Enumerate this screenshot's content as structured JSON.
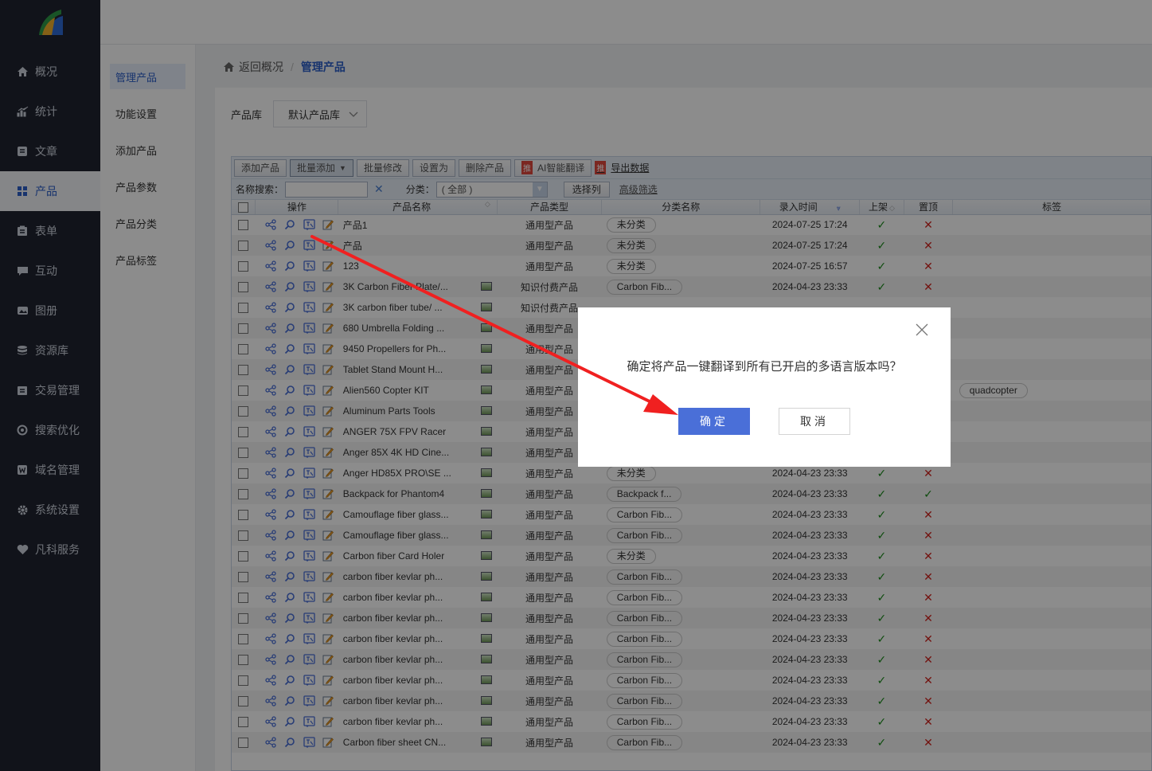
{
  "sidebar": {
    "items": [
      {
        "label": "概况",
        "icon": "home-icon"
      },
      {
        "label": "统计",
        "icon": "stats-icon"
      },
      {
        "label": "文章",
        "icon": "article-icon"
      },
      {
        "label": "产品",
        "icon": "product-icon",
        "active": true
      },
      {
        "label": "表单",
        "icon": "form-icon"
      },
      {
        "label": "互动",
        "icon": "chat-icon"
      },
      {
        "label": "图册",
        "icon": "gallery-icon"
      },
      {
        "label": "资源库",
        "icon": "database-icon"
      },
      {
        "label": "交易管理",
        "icon": "trade-icon"
      },
      {
        "label": "搜索优化",
        "icon": "seo-icon"
      },
      {
        "label": "域名管理",
        "icon": "domain-icon"
      },
      {
        "label": "系统设置",
        "icon": "gear-icon"
      },
      {
        "label": "凡科服务",
        "icon": "heart-icon"
      }
    ]
  },
  "submenu": {
    "items": [
      {
        "label": "管理产品",
        "active": true
      },
      {
        "label": "功能设置"
      },
      {
        "label": "添加产品"
      },
      {
        "label": "产品参数"
      },
      {
        "label": "产品分类"
      },
      {
        "label": "产品标签"
      }
    ]
  },
  "breadcrumb": {
    "back": "返回概况",
    "current": "管理产品"
  },
  "library": {
    "label": "产品库",
    "value": "默认产品库"
  },
  "toolbar": {
    "add": "添加产品",
    "batch_add": "批量添加",
    "batch_edit": "批量修改",
    "set_as": "设置为",
    "delete": "删除产品",
    "ai_badge": "推",
    "ai_translate": "AI智能翻译",
    "export_badge": "推",
    "export": "导出数据"
  },
  "search": {
    "name_label": "名称搜索：",
    "clear": "✕",
    "category_label": "分类：",
    "category_value": "( 全部 )",
    "select_columns": "选择列",
    "advanced": "高级筛选"
  },
  "table": {
    "columns": [
      "操作",
      "产品名称",
      "产品类型",
      "分类名称",
      "录入时间",
      "上架",
      "置顶",
      "标签"
    ],
    "rows": [
      {
        "name": "产品1",
        "img": false,
        "type": "通用型产品",
        "category": "未分类",
        "time": "2024-07-25 17:24",
        "on": true,
        "top": false,
        "tag": ""
      },
      {
        "name": "产品",
        "img": false,
        "type": "通用型产品",
        "category": "未分类",
        "time": "2024-07-25 17:24",
        "on": true,
        "top": false,
        "tag": ""
      },
      {
        "name": "123",
        "img": false,
        "type": "通用型产品",
        "category": "未分类",
        "time": "2024-07-25 16:57",
        "on": true,
        "top": false,
        "tag": ""
      },
      {
        "name": "3K Carbon Fiber Plate/...",
        "img": true,
        "type": "知识付费产品",
        "category": "Carbon Fib...",
        "time": "2024-04-23 23:33",
        "on": true,
        "top": false,
        "tag": ""
      },
      {
        "name": "3K carbon fiber tube/ ...",
        "img": true,
        "type": "知识付费产品",
        "category": "",
        "time": "",
        "on": null,
        "top": null,
        "tag": ""
      },
      {
        "name": "680 Umbrella Folding ...",
        "img": true,
        "type": "通用型产品",
        "category": "",
        "time": "",
        "on": null,
        "top": null,
        "tag": ""
      },
      {
        "name": "9450 Propellers for Ph...",
        "img": true,
        "type": "通用型产品",
        "category": "",
        "time": "",
        "on": null,
        "top": null,
        "tag": ""
      },
      {
        "name": "Tablet Stand Mount H...",
        "img": true,
        "type": "通用型产品",
        "category": "",
        "time": "",
        "on": null,
        "top": null,
        "tag": ""
      },
      {
        "name": "Alien560 Copter KIT",
        "img": true,
        "type": "通用型产品",
        "category": "",
        "time": "",
        "on": null,
        "top": null,
        "tag": "quadcopter"
      },
      {
        "name": "Aluminum Parts Tools",
        "img": true,
        "type": "通用型产品",
        "category": "",
        "time": "",
        "on": null,
        "top": null,
        "tag": ""
      },
      {
        "name": "ANGER 75X FPV Racer",
        "img": true,
        "type": "通用型产品",
        "category": "",
        "time": "",
        "on": null,
        "top": null,
        "tag": ""
      },
      {
        "name": "Anger 85X 4K HD Cine...",
        "img": true,
        "type": "通用型产品",
        "category": "",
        "time": "",
        "on": null,
        "top": null,
        "tag": ""
      },
      {
        "name": "Anger HD85X PRO\\SE ...",
        "img": true,
        "type": "通用型产品",
        "category": "未分类",
        "time": "2024-04-23 23:33",
        "on": true,
        "top": false,
        "tag": ""
      },
      {
        "name": "Backpack for Phantom4",
        "img": true,
        "type": "通用型产品",
        "category": "Backpack f...",
        "time": "2024-04-23 23:33",
        "on": true,
        "top": true,
        "tag": ""
      },
      {
        "name": "Camouflage fiber glass...",
        "img": true,
        "type": "通用型产品",
        "category": "Carbon Fib...",
        "time": "2024-04-23 23:33",
        "on": true,
        "top": false,
        "tag": ""
      },
      {
        "name": "Camouflage fiber glass...",
        "img": true,
        "type": "通用型产品",
        "category": "Carbon Fib...",
        "time": "2024-04-23 23:33",
        "on": true,
        "top": false,
        "tag": ""
      },
      {
        "name": "Carbon fiber Card Holer",
        "img": true,
        "type": "通用型产品",
        "category": "未分类",
        "time": "2024-04-23 23:33",
        "on": true,
        "top": false,
        "tag": ""
      },
      {
        "name": "carbon fiber kevlar ph...",
        "img": true,
        "type": "通用型产品",
        "category": "Carbon Fib...",
        "time": "2024-04-23 23:33",
        "on": true,
        "top": false,
        "tag": ""
      },
      {
        "name": "carbon fiber kevlar ph...",
        "img": true,
        "type": "通用型产品",
        "category": "Carbon Fib...",
        "time": "2024-04-23 23:33",
        "on": true,
        "top": false,
        "tag": ""
      },
      {
        "name": "carbon fiber kevlar ph...",
        "img": true,
        "type": "通用型产品",
        "category": "Carbon Fib...",
        "time": "2024-04-23 23:33",
        "on": true,
        "top": false,
        "tag": ""
      },
      {
        "name": "carbon fiber kevlar ph...",
        "img": true,
        "type": "通用型产品",
        "category": "Carbon Fib...",
        "time": "2024-04-23 23:33",
        "on": true,
        "top": false,
        "tag": ""
      },
      {
        "name": "carbon fiber kevlar ph...",
        "img": true,
        "type": "通用型产品",
        "category": "Carbon Fib...",
        "time": "2024-04-23 23:33",
        "on": true,
        "top": false,
        "tag": ""
      },
      {
        "name": "carbon fiber kevlar ph...",
        "img": true,
        "type": "通用型产品",
        "category": "Carbon Fib...",
        "time": "2024-04-23 23:33",
        "on": true,
        "top": false,
        "tag": ""
      },
      {
        "name": "carbon fiber kevlar ph...",
        "img": true,
        "type": "通用型产品",
        "category": "Carbon Fib...",
        "time": "2024-04-23 23:33",
        "on": true,
        "top": false,
        "tag": ""
      },
      {
        "name": "carbon fiber kevlar ph...",
        "img": true,
        "type": "通用型产品",
        "category": "Carbon Fib...",
        "time": "2024-04-23 23:33",
        "on": true,
        "top": false,
        "tag": ""
      },
      {
        "name": "Carbon fiber sheet CN...",
        "img": true,
        "type": "通用型产品",
        "category": "Carbon Fib...",
        "time": "2024-04-23 23:33",
        "on": true,
        "top": false,
        "tag": ""
      }
    ]
  },
  "dialog": {
    "message": "确定将产品一键翻译到所有已开启的多语言版本吗？",
    "confirm": "确定",
    "cancel": "取消"
  },
  "colors": {
    "primary": "#4a6fd8",
    "sidebar": "#1f2330",
    "check": "#1a8a1a",
    "cross": "#d1221c",
    "arrow": "#f02020"
  }
}
